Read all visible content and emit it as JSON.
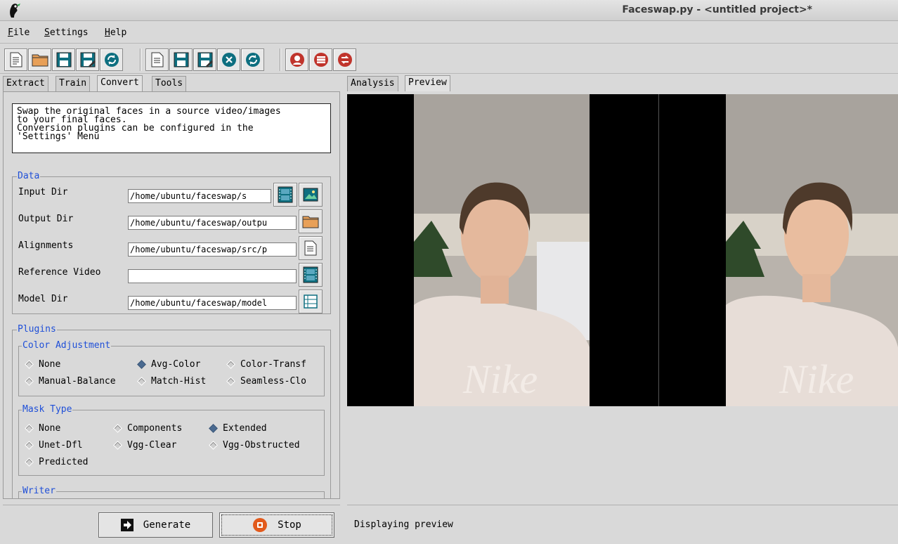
{
  "window": {
    "title": "Faceswap.py - <untitled project>*"
  },
  "menubar": {
    "items": [
      {
        "label": "File",
        "key": "F",
        "rest": "ile"
      },
      {
        "label": "Settings",
        "key": "S",
        "rest": "ettings"
      },
      {
        "label": "Help",
        "key": "H",
        "rest": "elp"
      }
    ]
  },
  "toolbar": {
    "icons": [
      "new-project-icon",
      "open-project-icon",
      "save-project-icon",
      "save-project-as-icon",
      "reload-project-icon",
      "new-task-icon",
      "save-task-icon",
      "save-task-as-icon",
      "clear-task-icon",
      "reload-task-icon",
      "settings-extract-icon",
      "settings-train-icon",
      "settings-convert-icon"
    ]
  },
  "left_tabs": [
    "Extract",
    "Train",
    "Convert",
    "Tools"
  ],
  "left_tabs_active": "Convert",
  "right_tabs": [
    "Analysis",
    "Preview"
  ],
  "right_tabs_active": "Preview",
  "info_text": "Swap the original faces in a source video/images\nto your final faces.\nConversion plugins can be configured in the\n'Settings' Menu",
  "data_section": {
    "legend": "Data",
    "fields": [
      {
        "label": "Input Dir",
        "value": "/home/ubuntu/faceswap/s"
      },
      {
        "label": "Output Dir",
        "value": "/home/ubuntu/faceswap/outpu"
      },
      {
        "label": "Alignments",
        "value": "/home/ubuntu/faceswap/src/p"
      },
      {
        "label": "Reference Video",
        "value": ""
      },
      {
        "label": "Model Dir",
        "value": "/home/ubuntu/faceswap/model"
      }
    ]
  },
  "plugins": {
    "legend": "Plugins",
    "color_adjustment": {
      "legend": "Color Adjustment",
      "options": [
        "None",
        "Avg-Color",
        "Color-Transf",
        "Manual-Balance",
        "Match-Hist",
        "Seamless-Clo"
      ],
      "selected": "Avg-Color"
    },
    "mask_type": {
      "legend": "Mask Type",
      "options": [
        "None",
        "Components",
        "Extended",
        "Unet-Dfl",
        "Vgg-Clear",
        "Vgg-Obstructed",
        "Predicted"
      ],
      "selected": "Extended"
    },
    "writer": {
      "legend": "Writer"
    }
  },
  "buttons": {
    "generate": "Generate",
    "stop": "Stop"
  },
  "status": {
    "text": "Displaying preview"
  },
  "colors": {
    "legend_blue": "#1f4fd8",
    "toolbar_teal": "#0e6f80",
    "toolbar_red": "#c0342c",
    "radio_selected": "#4a6a90"
  }
}
